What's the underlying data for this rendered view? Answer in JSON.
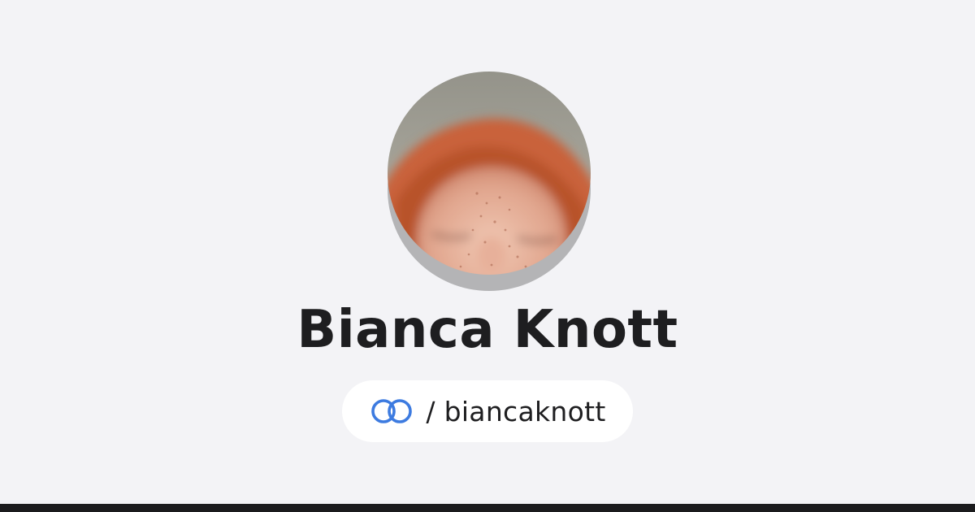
{
  "profile": {
    "name": "Bianca Knott",
    "handle": "/ biancaknott"
  },
  "icons": {
    "brand_logo": "linked-rings-icon",
    "avatar": "profile-photo"
  },
  "colors": {
    "background": "#f3f3f6",
    "pill": "#ffffff",
    "text": "#1e1e20",
    "accent": "#3d7be0",
    "bottom_bar": "#1b1b1d"
  }
}
